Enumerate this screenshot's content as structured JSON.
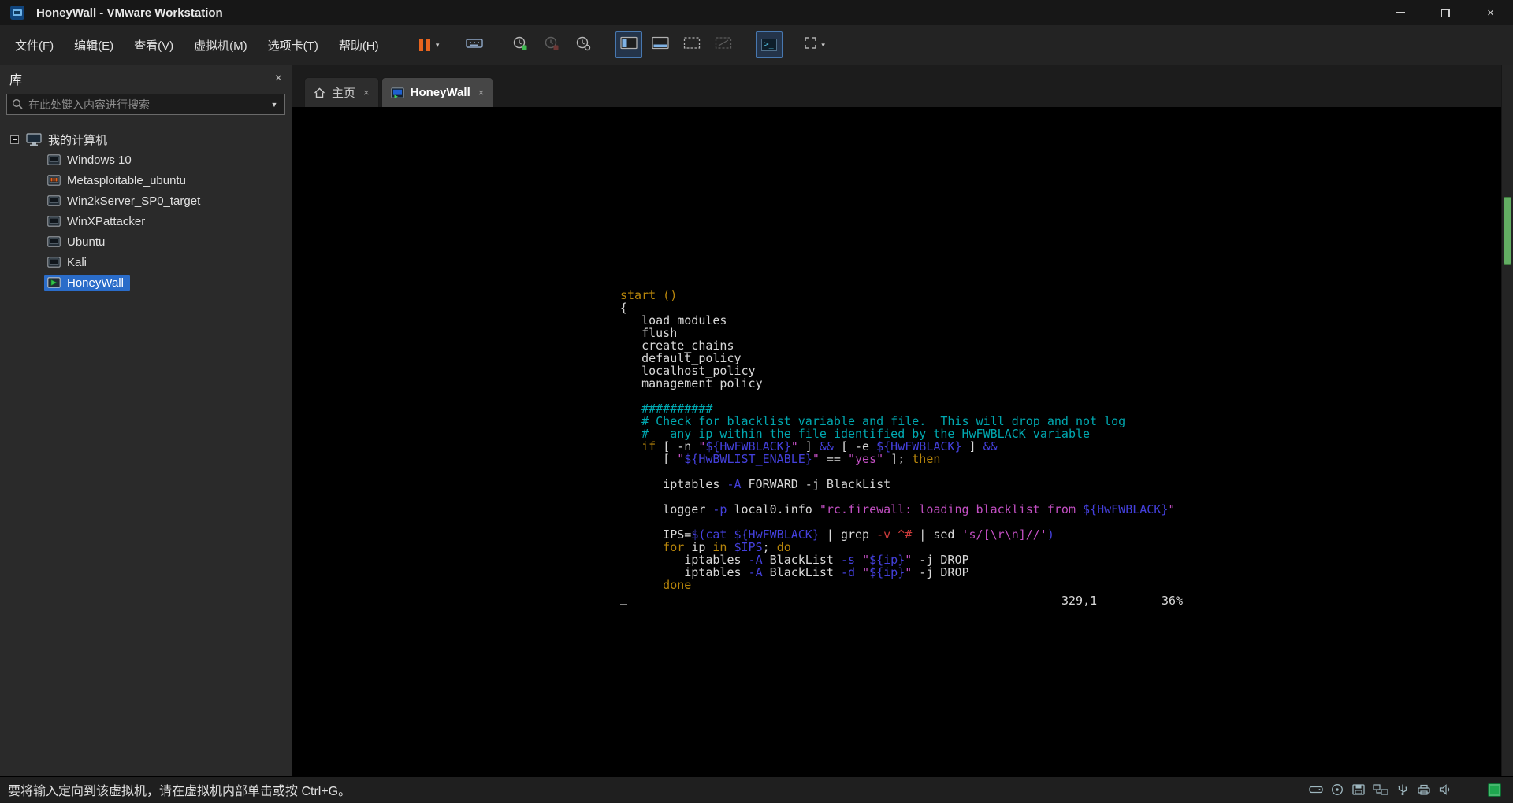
{
  "window": {
    "title": "HoneyWall - VMware Workstation"
  },
  "glyphs": {
    "caret_down": "▾",
    "close": "×",
    "dropdown_arrow": "▼"
  },
  "menu": {
    "items": [
      "文件(F)",
      "编辑(E)",
      "查看(V)",
      "虚拟机(M)",
      "选项卡(T)",
      "帮助(H)"
    ]
  },
  "library": {
    "header": "库",
    "search_placeholder": "在此处键入内容进行搜索",
    "root_label": "我的计算机",
    "vms": [
      "Windows 10",
      "Metasploitable_ubuntu",
      "Win2kServer_SP0_target",
      "WinXPattacker",
      "Ubuntu",
      "Kali",
      "HoneyWall"
    ],
    "selected": "HoneyWall"
  },
  "tabs": {
    "home": "主页",
    "vm": "HoneyWall"
  },
  "vim": {
    "colors": {
      "w": "#d8d8d8",
      "y": "#b8860b",
      "c": "#00a8b0",
      "m": "#c24fc2",
      "b": "#4440dc",
      "r": "#cc3b3b"
    },
    "lines": [
      [
        [
          "y",
          "start ()"
        ]
      ],
      [
        [
          "w",
          "{"
        ]
      ],
      [
        [
          "w",
          "   load_modules"
        ]
      ],
      [
        [
          "w",
          "   flush"
        ]
      ],
      [
        [
          "w",
          "   create_chains"
        ]
      ],
      [
        [
          "w",
          "   default_policy"
        ]
      ],
      [
        [
          "w",
          "   localhost_policy"
        ]
      ],
      [
        [
          "w",
          "   management_policy"
        ]
      ],
      [],
      [
        [
          "c",
          "   ##########"
        ]
      ],
      [
        [
          "c",
          "   # Check for blacklist variable and file.  This will drop and not log"
        ]
      ],
      [
        [
          "c",
          "   #   any ip within the file identified by the HwFWBLACK variable"
        ]
      ],
      [
        [
          "y",
          "   if "
        ],
        [
          "w",
          "[ -n "
        ],
        [
          "m",
          "\""
        ],
        [
          "b",
          "${HwFWBLACK}"
        ],
        [
          "m",
          "\""
        ],
        [
          "w",
          " ] "
        ],
        [
          "b",
          "&&"
        ],
        [
          "w",
          " [ -e "
        ],
        [
          "b",
          "${HwFWBLACK}"
        ],
        [
          "w",
          " ] "
        ],
        [
          "b",
          "&&"
        ]
      ],
      [
        [
          "w",
          "      [ "
        ],
        [
          "m",
          "\""
        ],
        [
          "b",
          "${HwBWLIST_ENABLE}"
        ],
        [
          "m",
          "\""
        ],
        [
          "w",
          " == "
        ],
        [
          "m",
          "\"yes\""
        ],
        [
          "w",
          " ]; "
        ],
        [
          "y",
          "then"
        ]
      ],
      [],
      [
        [
          "w",
          "      iptables "
        ],
        [
          "b",
          "-A"
        ],
        [
          "w",
          " FORWARD -j BlackList"
        ]
      ],
      [],
      [
        [
          "w",
          "      logger "
        ],
        [
          "b",
          "-p"
        ],
        [
          "w",
          " local0.info "
        ],
        [
          "m",
          "\"rc.firewall: loading blacklist from "
        ],
        [
          "b",
          "${HwFWBLACK}"
        ],
        [
          "m",
          "\""
        ]
      ],
      [],
      [
        [
          "w",
          "      IPS="
        ],
        [
          "b",
          "$(cat ${HwFWBLACK}"
        ],
        [
          "w",
          " | grep "
        ],
        [
          "r",
          "-v ^#"
        ],
        [
          "w",
          " | sed "
        ],
        [
          "m",
          "'s/[\\r\\n]//'"
        ],
        [
          "b",
          ")"
        ]
      ],
      [
        [
          "y",
          "      for "
        ],
        [
          "w",
          "ip "
        ],
        [
          "y",
          "in "
        ],
        [
          "b",
          "$IPS"
        ],
        [
          "w",
          "; "
        ],
        [
          "y",
          "do"
        ]
      ],
      [
        [
          "w",
          "         iptables "
        ],
        [
          "b",
          "-A"
        ],
        [
          "w",
          " BlackList "
        ],
        [
          "b",
          "-s"
        ],
        [
          "w",
          " "
        ],
        [
          "m",
          "\""
        ],
        [
          "b",
          "${ip}"
        ],
        [
          "m",
          "\""
        ],
        [
          "w",
          " -j DROP"
        ]
      ],
      [
        [
          "w",
          "         iptables "
        ],
        [
          "b",
          "-A"
        ],
        [
          "w",
          " BlackList "
        ],
        [
          "b",
          "-d"
        ],
        [
          "w",
          " "
        ],
        [
          "m",
          "\""
        ],
        [
          "b",
          "${ip}"
        ],
        [
          "m",
          "\""
        ],
        [
          "w",
          " -j DROP"
        ]
      ],
      [
        [
          "y",
          "      done"
        ]
      ],
      [
        [
          "w",
          "_"
        ]
      ]
    ],
    "ruler": "329,1",
    "percent": "36%"
  },
  "statusbar": {
    "message": "要将输入定向到该虚拟机，请在虚拟机内部单击或按 Ctrl+G。"
  }
}
